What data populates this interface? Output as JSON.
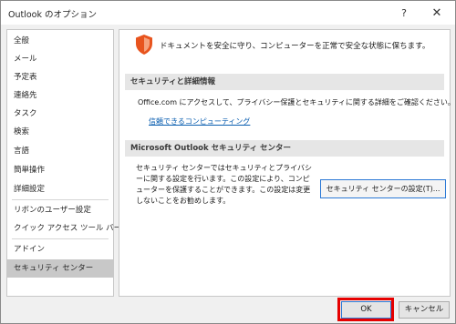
{
  "window": {
    "title": "Outlook のオプション",
    "help_glyph": "?",
    "close_glyph": "✕"
  },
  "sidebar": {
    "items": [
      {
        "label": "全般",
        "selected": false
      },
      {
        "label": "メール",
        "selected": false
      },
      {
        "label": "予定表",
        "selected": false
      },
      {
        "label": "連絡先",
        "selected": false
      },
      {
        "label": "タスク",
        "selected": false
      },
      {
        "label": "検索",
        "selected": false
      },
      {
        "label": "言語",
        "selected": false
      },
      {
        "label": "簡単操作",
        "selected": false
      },
      {
        "label": "詳細設定",
        "selected": false
      },
      {
        "label": "リボンのユーザー設定",
        "selected": false
      },
      {
        "label": "クイック アクセス ツール バー",
        "selected": false
      },
      {
        "label": "アドイン",
        "selected": false
      },
      {
        "label": "セキュリティ センター",
        "selected": true
      }
    ]
  },
  "content": {
    "intro": "ドキュメントを安全に守り、コンピューターを正常で安全な状態に保ちます。",
    "privacy_section": {
      "heading": "セキュリティと詳細情報",
      "text": "Office.com にアクセスして、プライバシー保護とセキュリティに関する詳細をご確認ください。",
      "link": "信頼できるコンピューティング"
    },
    "trust_center_section": {
      "heading": "Microsoft Outlook セキュリティ センター",
      "text": "セキュリティ センターではセキュリティとプライバシーに関する設定を行います。この設定により、コンピューターを保護することができます。この設定は変更しないことをお勧めします。",
      "button": "セキュリティ センターの設定(T)..."
    }
  },
  "footer": {
    "ok": "OK",
    "cancel": "キャンセル"
  },
  "colors": {
    "accent": "#2b79d6",
    "highlight": "#e60000",
    "shield": "#e8541e",
    "link": "#0a5eb0"
  },
  "icons": {
    "shield": "shield-icon",
    "help": "help-icon",
    "close": "close-icon"
  }
}
